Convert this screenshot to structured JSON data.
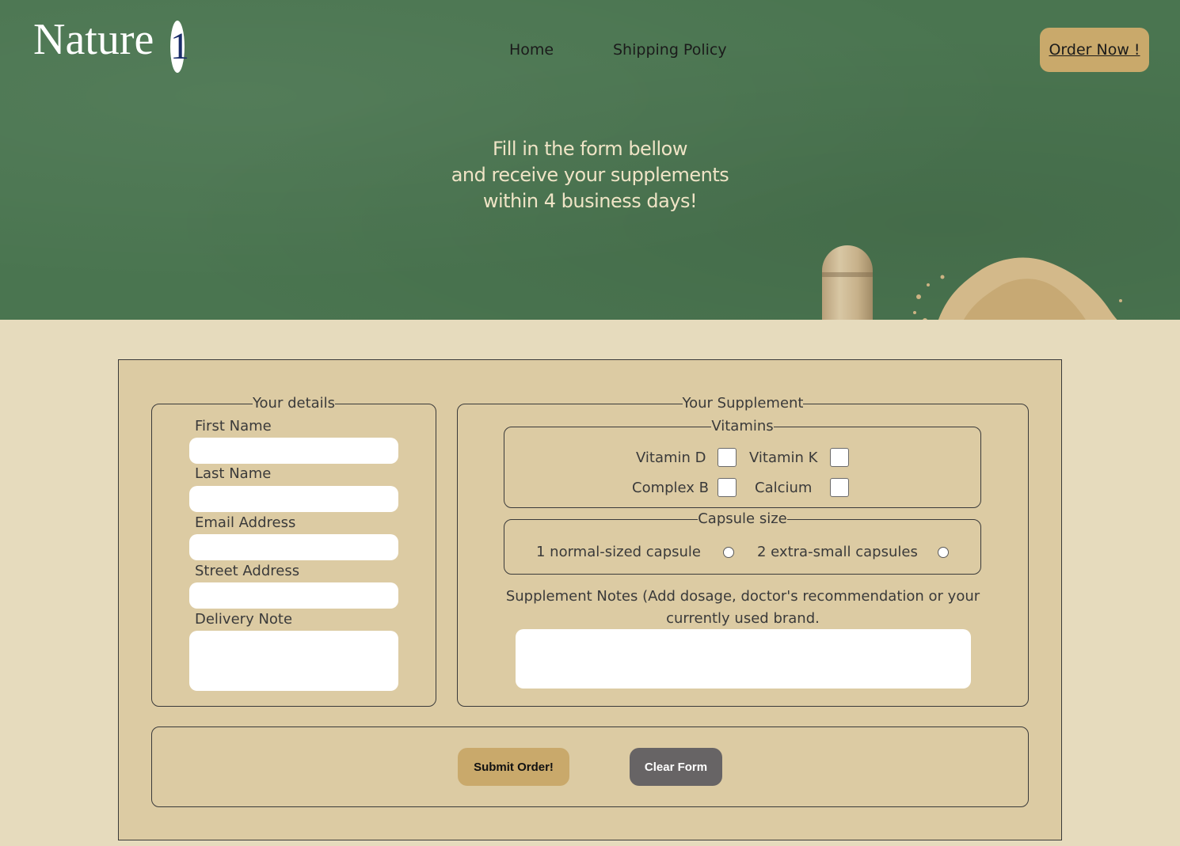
{
  "header": {
    "logo_text": "Nature",
    "logo_badge": "1",
    "nav": [
      {
        "label": "Home"
      },
      {
        "label": "Shipping Policy"
      }
    ],
    "order_button": "Order Now !"
  },
  "hero": {
    "lines": [
      "Fill in the form bellow",
      "and receive your supplements",
      "within 4 business days!"
    ]
  },
  "form": {
    "details": {
      "legend": "Your details",
      "fields": [
        {
          "label": "First Name",
          "value": ""
        },
        {
          "label": "Last Name",
          "value": ""
        },
        {
          "label": "Email Address",
          "value": ""
        },
        {
          "label": "Street Address",
          "value": ""
        },
        {
          "label": "Delivery Note",
          "value": ""
        }
      ]
    },
    "supplement": {
      "legend": "Your Supplement",
      "vitamins": {
        "legend": "Vitamins",
        "options": [
          {
            "label": "Vitamin D",
            "checked": false
          },
          {
            "label": "Vitamin K",
            "checked": false
          },
          {
            "label": "Complex B",
            "checked": false
          },
          {
            "label": "Calcium",
            "checked": false
          }
        ]
      },
      "capsule": {
        "legend": "Capsule size",
        "options": [
          {
            "label": "1 normal-sized capsule",
            "selected": false
          },
          {
            "label": "2 extra-small capsules",
            "selected": false
          }
        ]
      },
      "notes_label": "Supplement Notes (Add dosage, doctor's recommendation or your currently used brand.",
      "notes_value": ""
    },
    "actions": {
      "submit": "Submit Order!",
      "clear": "Clear Form"
    }
  },
  "colors": {
    "hero_green": "#4a7550",
    "page_bg": "#e6dbbd",
    "card_bg": "#dccba3",
    "accent_gold": "#c9a96b",
    "clear_gray": "#676465",
    "hero_text": "#efe4c6"
  }
}
